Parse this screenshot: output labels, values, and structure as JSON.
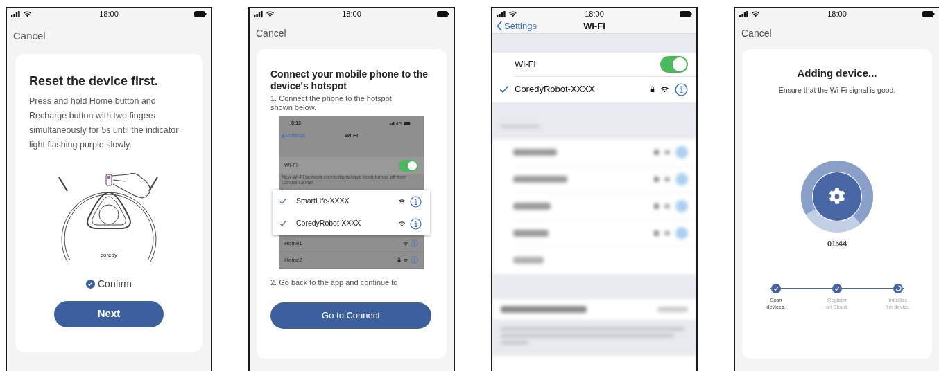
{
  "screens": [
    {
      "kind": "reset",
      "time": "18:00",
      "cancel": "Cancel",
      "title": "Reset the device first.",
      "body": "Press and hold Home button and Recharge button with two fingers simultaneously for 5s until the indicator light flashing purple slowly.",
      "logo": "coredy",
      "confirm": {
        "label": "Confirm",
        "checked": true
      },
      "button": "Next"
    },
    {
      "kind": "hotspot",
      "time": "18:00",
      "cancel": "Cancel",
      "title": "Connect your mobile phone to the device's hotspot",
      "step_1": "1. Connect the phone to the hotspot shown below.",
      "example": {
        "time": "8:13",
        "network_type": "4G",
        "back": "Settings",
        "title": "Wi-Fi",
        "wifi_label": "Wi-Fi",
        "wifi_on": true,
        "note": "New Wi-Fi network connections have been turned off from Control Center.",
        "highlighted": [
          {
            "name": "SmartLife-XXXX",
            "selected": true
          },
          {
            "name": "CoredyRobot-XXXX",
            "selected": true
          }
        ],
        "networks": [
          {
            "name": "Home1",
            "locked": false
          },
          {
            "name": "Home2",
            "locked": true
          }
        ]
      },
      "step_2": "2. Go back to the app and continue to",
      "button": "Go to Connect"
    },
    {
      "kind": "wifi_settings",
      "time": "18:00",
      "back": "Settings",
      "title": "Wi-Fi",
      "wifi_label": "Wi-Fi",
      "wifi_on": true,
      "connected": {
        "name": "CoredyRobot-XXXX",
        "selected": true,
        "locked": true
      }
    },
    {
      "kind": "adding",
      "time": "18:00",
      "cancel": "Cancel",
      "title": "Adding device...",
      "subtitle": "Ensure that the Wi-Fi signal is good.",
      "progress": {
        "level": 0.72
      },
      "timer": "01:44",
      "steps": [
        {
          "label": "Scan\ndevices.",
          "done": true,
          "highlighted": true
        },
        {
          "label": "Register\non Cloud.",
          "done": true,
          "highlighted": false
        },
        {
          "label": "Initialize\nthe device.",
          "done": false,
          "highlighted": false
        }
      ]
    }
  ]
}
